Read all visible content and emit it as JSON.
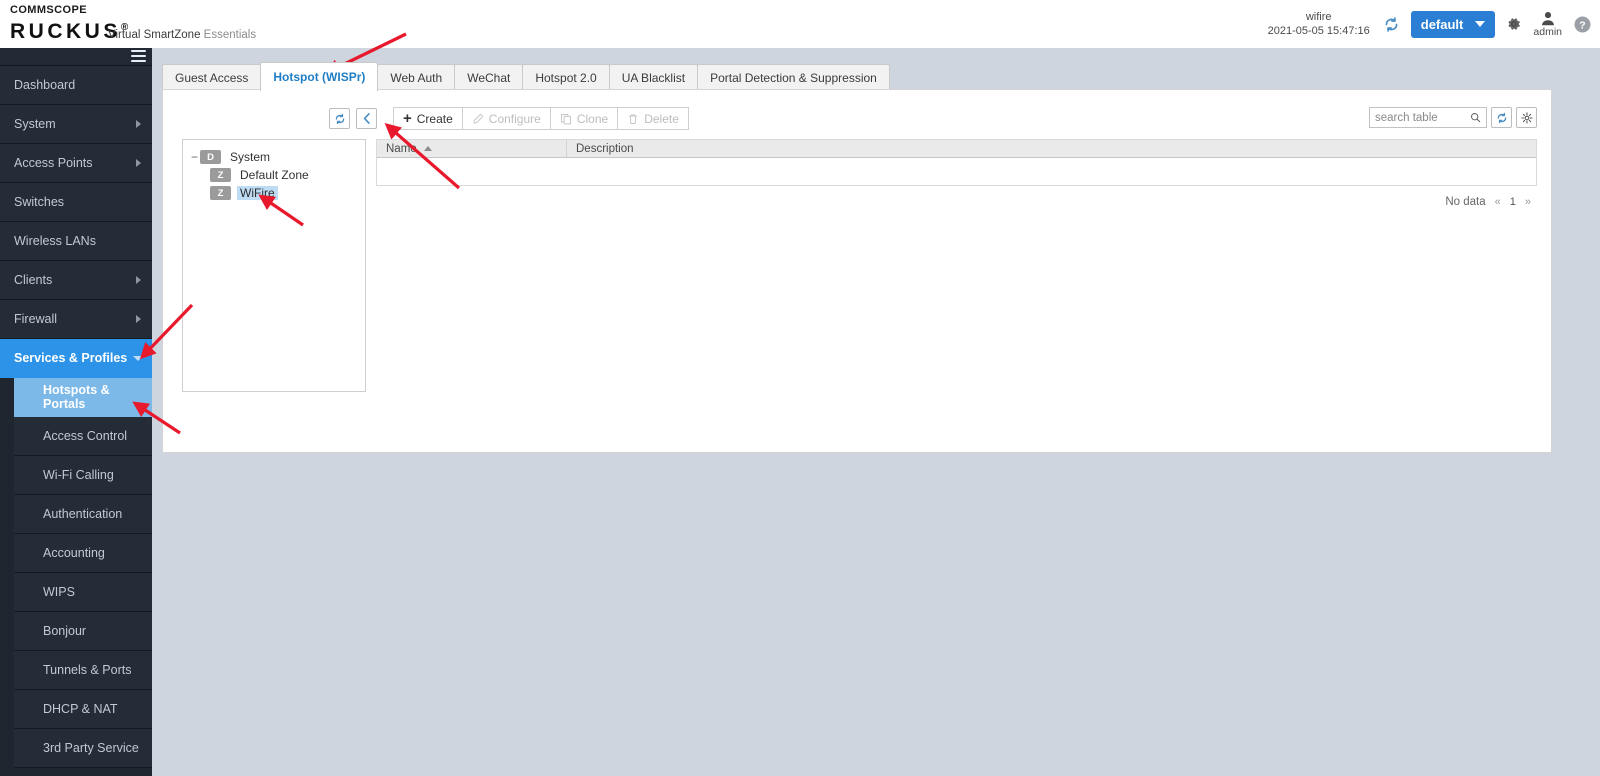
{
  "header": {
    "brand_commscope": "COMMSCOPE",
    "brand_ruckus": "RUCKUS",
    "product_name": "Virtual SmartZone",
    "product_edition": "Essentials",
    "tenant": "wifire",
    "datetime": "2021-05-05  15:47:16",
    "refresh_icon": "refresh-icon",
    "domain_selector": "default",
    "settings_icon": "gear-icon",
    "user_icon": "user-avatar-icon",
    "username": "admin",
    "help_icon": "help-icon"
  },
  "sidebar": {
    "menu_toggle_icon": "hamburger-icon",
    "items": [
      {
        "label": "Dashboard",
        "has_arrow": false,
        "state": "normal"
      },
      {
        "label": "System",
        "has_arrow": true,
        "state": "normal"
      },
      {
        "label": "Access Points",
        "has_arrow": true,
        "state": "normal"
      },
      {
        "label": "Switches",
        "has_arrow": false,
        "state": "normal"
      },
      {
        "label": "Wireless LANs",
        "has_arrow": false,
        "state": "normal"
      },
      {
        "label": "Clients",
        "has_arrow": true,
        "state": "normal"
      },
      {
        "label": "Firewall",
        "has_arrow": true,
        "state": "normal"
      },
      {
        "label": "Services & Profiles",
        "has_arrow": true,
        "state": "active"
      }
    ],
    "subitems": [
      {
        "label": "Hotspots & Portals",
        "state": "active"
      },
      {
        "label": "Access Control",
        "state": "normal"
      },
      {
        "label": "Wi-Fi Calling",
        "state": "normal"
      },
      {
        "label": "Authentication",
        "state": "normal"
      },
      {
        "label": "Accounting",
        "state": "normal"
      },
      {
        "label": "WIPS",
        "state": "normal"
      },
      {
        "label": "Bonjour",
        "state": "normal"
      },
      {
        "label": "Tunnels & Ports",
        "state": "normal"
      },
      {
        "label": "DHCP & NAT",
        "state": "normal"
      },
      {
        "label": "3rd Party Service",
        "state": "normal"
      }
    ]
  },
  "tabs": [
    {
      "label": "Guest Access",
      "active": false
    },
    {
      "label": "Hotspot (WISPr)",
      "active": true
    },
    {
      "label": "Web Auth",
      "active": false
    },
    {
      "label": "WeChat",
      "active": false
    },
    {
      "label": "Hotspot 2.0",
      "active": false
    },
    {
      "label": "UA Blacklist",
      "active": false
    },
    {
      "label": "Portal Detection & Suppression",
      "active": false
    }
  ],
  "toolbar": {
    "refresh_icon": "refresh-icon",
    "collapse_icon": "chevron-left-icon",
    "create_label": "Create",
    "configure_label": "Configure",
    "clone_label": "Clone",
    "delete_label": "Delete",
    "create_icon": "plus-icon",
    "configure_icon": "pencil-icon",
    "clone_icon": "copy-icon",
    "delete_icon": "trash-icon"
  },
  "search": {
    "placeholder": "search table",
    "value": "",
    "search_icon": "search-icon",
    "refresh_icon": "refresh-icon",
    "settings_icon": "gear-icon"
  },
  "tree": {
    "nodes": [
      {
        "badge": "D",
        "label": "System",
        "level": 1,
        "expander": "−",
        "selected": false
      },
      {
        "badge": "Z",
        "label": "Default Zone",
        "level": 2,
        "expander": "",
        "selected": false
      },
      {
        "badge": "Z",
        "label": "WiFire",
        "level": 2,
        "expander": "",
        "selected": true
      }
    ]
  },
  "table": {
    "columns": [
      {
        "label": "Name",
        "sorted": "asc"
      },
      {
        "label": "Description",
        "sorted": ""
      }
    ],
    "rows": [],
    "empty_text": "No data",
    "pager": {
      "first": "«",
      "page": "1",
      "last": "»"
    }
  },
  "annotation_color": "#e8192c"
}
